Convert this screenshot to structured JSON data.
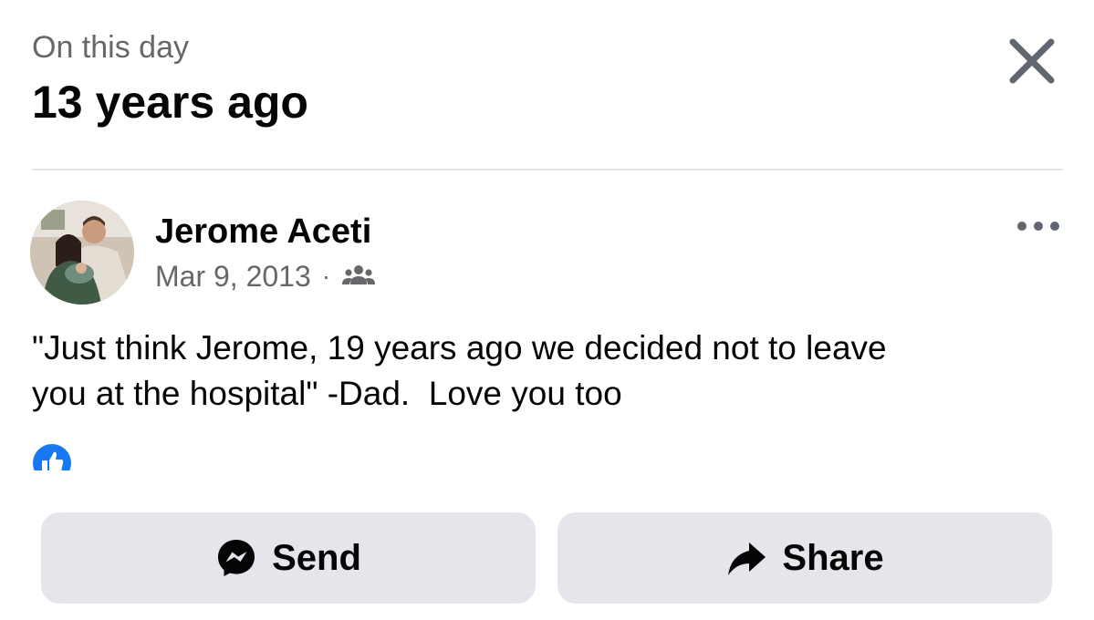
{
  "header": {
    "subtitle": "On this day",
    "title": "13 years ago"
  },
  "post": {
    "author": "Jerome Aceti",
    "date": "Mar 9, 2013",
    "separator": "·",
    "audience_icon": "friends-icon",
    "text": "\"Just think Jerome, 19 years ago we decided not to leave\nyou at the hospital\" -Dad.  Love you too",
    "reaction_icon": "like-icon"
  },
  "actions": {
    "send_label": "Send",
    "share_label": "Share"
  },
  "icons": {
    "close": "close-icon",
    "more": "more-options-icon",
    "send": "messenger-icon",
    "share": "share-arrow-icon"
  },
  "colors": {
    "like_blue": "#1877f2",
    "secondary_text": "#65676b",
    "button_bg": "#e4e6eb",
    "primary_text": "#050505"
  }
}
